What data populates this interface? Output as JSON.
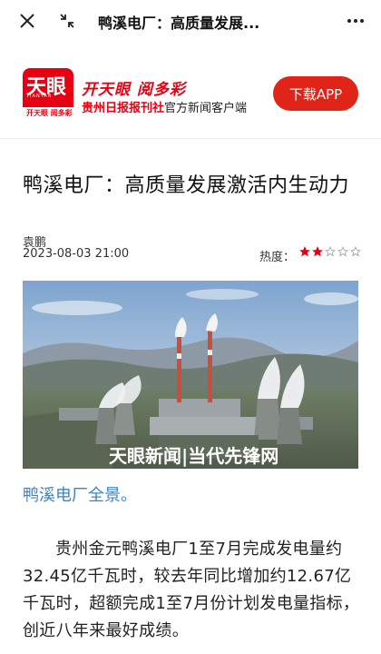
{
  "topbar": {
    "title": "鸭溪电厂：高质量发展...",
    "close_icon": "close-icon",
    "collapse_icon": "collapse-icon",
    "more_icon": "more-icon"
  },
  "banner": {
    "logo_text": "天眼",
    "logo_tiny": "TIANYAN",
    "logo_strip": "开天眼 阅多彩",
    "slogan": "开天眼 阅多彩",
    "sub_red": "贵州日报报刊社",
    "sub_rest": "官方新闻客户端",
    "download_label": "下载APP",
    "brand_color": "#e60012"
  },
  "article": {
    "title": "鸭溪电厂：高质量发展激活内生动力",
    "author": "袁鹏",
    "date": "2023-08-03 21:00",
    "heat_label": "热度：",
    "heat_level": 2,
    "heat_max": 5,
    "photo_watermark": "天眼新闻|当代先锋网",
    "caption": "鸭溪电厂全景。",
    "paragraph": "贵州金元鸭溪电厂1至7月完成发电量约32.45亿千瓦时，较去年同比增加约12.67亿千瓦时，超额完成1至7月份计划发电量指标，创近八年来最好成绩。"
  }
}
